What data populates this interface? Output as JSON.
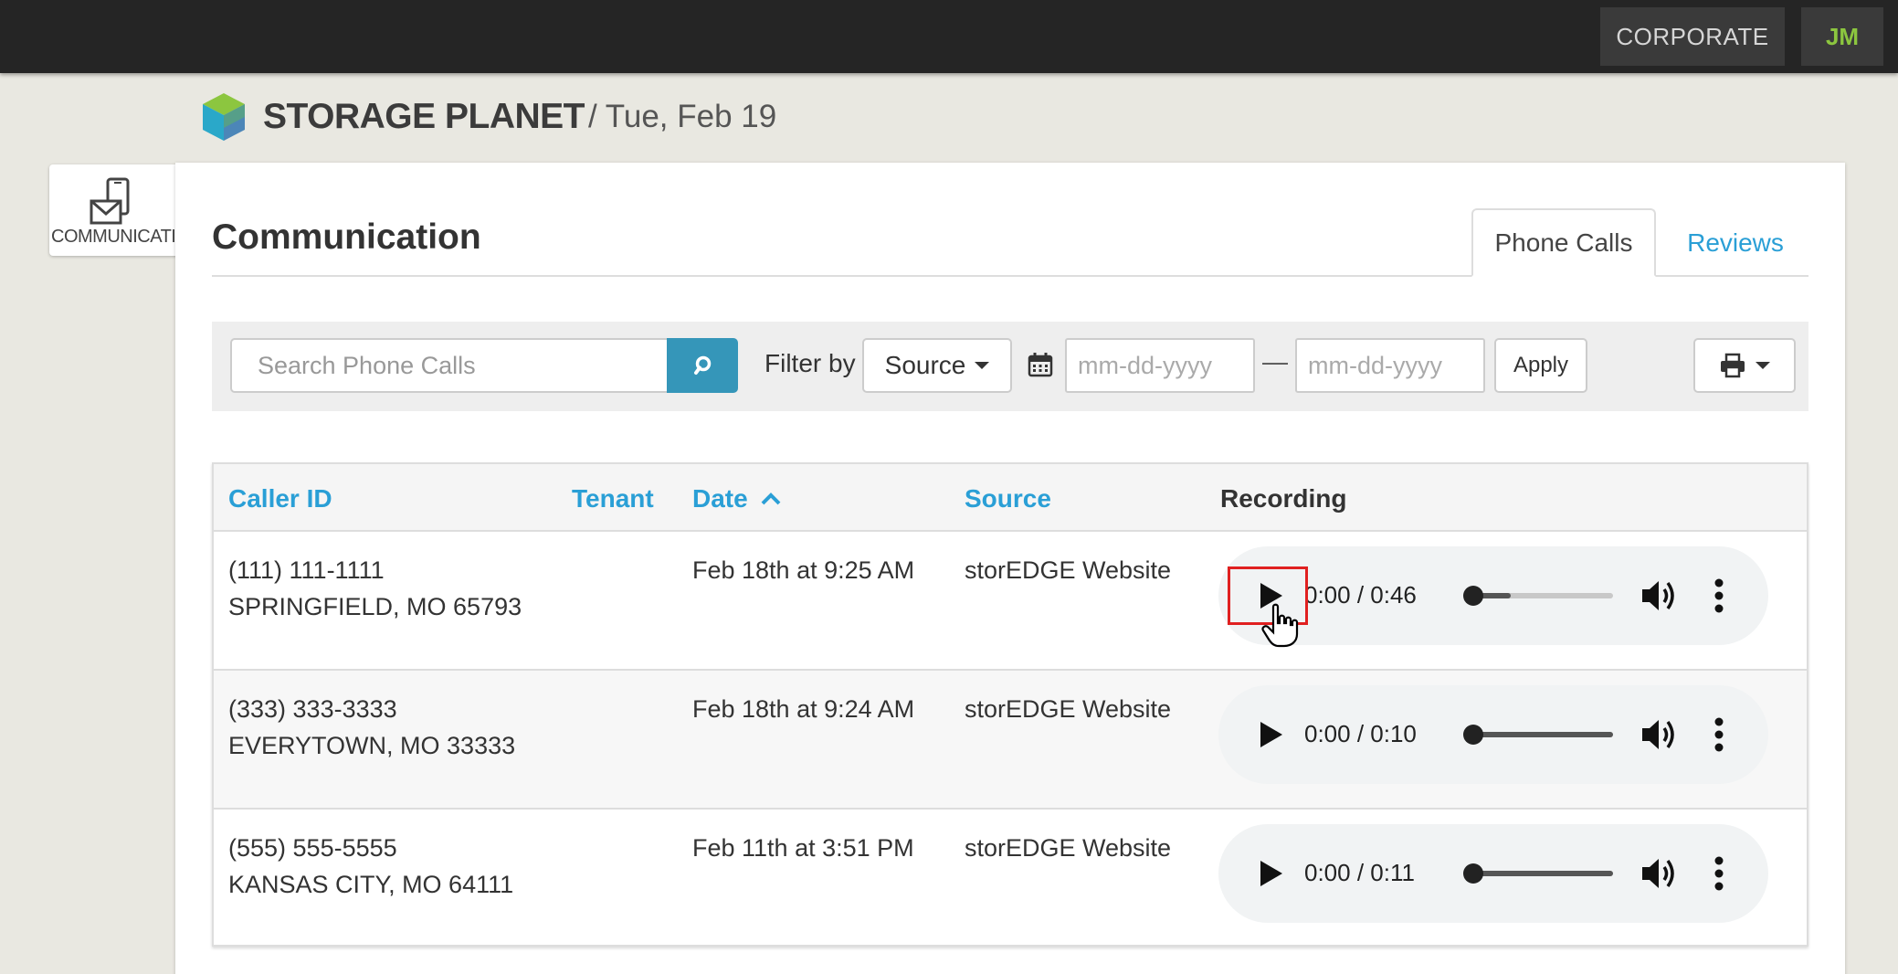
{
  "topbar": {
    "corporate_label": "CORPORATE",
    "user_initials": "JM"
  },
  "brand": {
    "name": "STORAGE PLANET",
    "date": "/ Tue, Feb 19"
  },
  "module": {
    "label": "COMMUNICATIONS"
  },
  "page": {
    "title": "Communication",
    "tabs": [
      {
        "label": "Phone Calls",
        "active": true
      },
      {
        "label": "Reviews",
        "active": false
      }
    ]
  },
  "toolbar": {
    "search_placeholder": "Search Phone Calls",
    "filter_label": "Filter by",
    "source_label": "Source",
    "date_from_placeholder": "mm-dd-yyyy",
    "date_separator": "—",
    "date_to_placeholder": "mm-dd-yyyy",
    "apply_label": "Apply"
  },
  "table": {
    "headers": {
      "caller_id": "Caller ID",
      "tenant": "Tenant",
      "date": "Date",
      "source": "Source",
      "recording": "Recording"
    },
    "rows": [
      {
        "phone": "(111) 111-1111",
        "location": "SPRINGFIELD, MO 65793",
        "tenant": "",
        "date": "Feb 18th at 9:25 AM",
        "source": "storEDGE Website",
        "time": "0:00 / 0:46",
        "buffered": 0.3
      },
      {
        "phone": "(333) 333-3333",
        "location": "EVERYTOWN, MO 33333",
        "tenant": "",
        "date": "Feb 18th at 9:24 AM",
        "source": "storEDGE Website",
        "time": "0:00 / 0:10",
        "buffered": 1.0
      },
      {
        "phone": "(555) 555-5555",
        "location": "KANSAS CITY, MO 64111",
        "tenant": "",
        "date": "Feb 11th at 3:51 PM",
        "source": "storEDGE Website",
        "time": "0:00 / 0:11",
        "buffered": 1.0
      }
    ]
  },
  "colors": {
    "accent": "#2a9fd6",
    "search_button": "#3596b9",
    "user_initials": "#8cc63f",
    "topbar": "#252525"
  }
}
